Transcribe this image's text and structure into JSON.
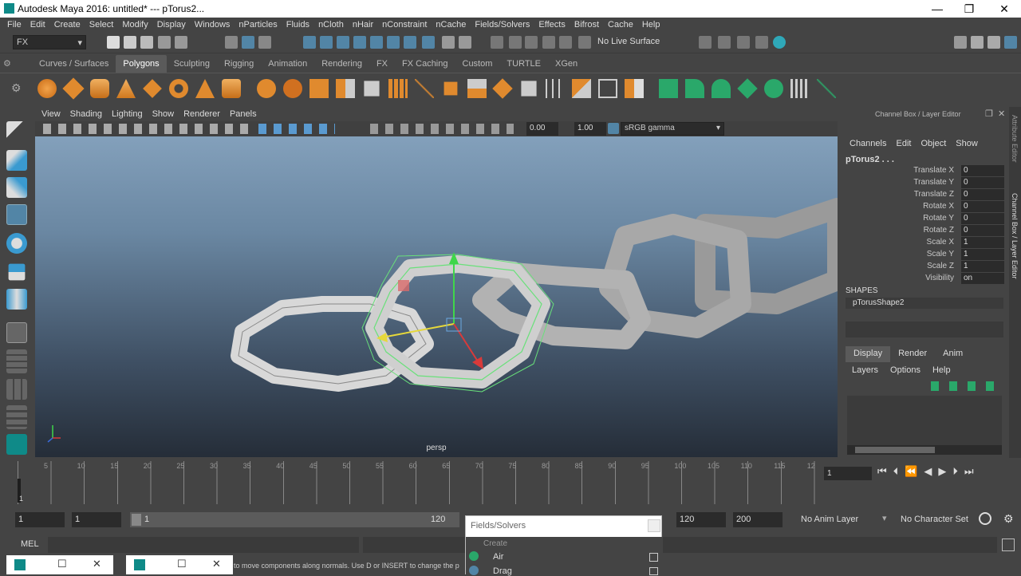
{
  "window": {
    "title": "Autodesk Maya 2016: untitled*   ---   pTorus2...",
    "minimize": "—",
    "restore": "❐",
    "close": "✕"
  },
  "menus": [
    "File",
    "Edit",
    "Create",
    "Select",
    "Modify",
    "Display",
    "Windows",
    "nParticles",
    "Fluids",
    "nCloth",
    "nHair",
    "nConstraint",
    "nCache",
    "Fields/Solvers",
    "Effects",
    "Bifrost",
    "Cache",
    "Help"
  ],
  "status": {
    "menuset": "FX",
    "live_surface": "No Live Surface"
  },
  "shelf_tabs": [
    "Curves / Surfaces",
    "Polygons",
    "Sculpting",
    "Rigging",
    "Animation",
    "Rendering",
    "FX",
    "FX Caching",
    "Custom",
    "TURTLE",
    "XGen"
  ],
  "active_shelf": "Polygons",
  "viewport": {
    "menus": [
      "View",
      "Shading",
      "Lighting",
      "Show",
      "Renderer",
      "Panels"
    ],
    "exposure": "0.00",
    "gamma": "1.00",
    "colorspace": "sRGB gamma",
    "camera": "persp"
  },
  "channel_box": {
    "title": "Channel Box / Layer Editor",
    "menus": [
      "Channels",
      "Edit",
      "Object",
      "Show"
    ],
    "object": "pTorus2 . . .",
    "attrs": [
      {
        "name": "Translate X",
        "value": "0"
      },
      {
        "name": "Translate Y",
        "value": "0"
      },
      {
        "name": "Translate Z",
        "value": "0"
      },
      {
        "name": "Rotate X",
        "value": "0"
      },
      {
        "name": "Rotate Y",
        "value": "0"
      },
      {
        "name": "Rotate Z",
        "value": "0"
      },
      {
        "name": "Scale X",
        "value": "1"
      },
      {
        "name": "Scale Y",
        "value": "1"
      },
      {
        "name": "Scale Z",
        "value": "1"
      },
      {
        "name": "Visibility",
        "value": "on"
      }
    ],
    "shapes_label": "SHAPES",
    "shape": "pTorusShape2",
    "layer_tabs": [
      "Display",
      "Render",
      "Anim"
    ],
    "layer_menus": [
      "Layers",
      "Options",
      "Help"
    ],
    "side_tabs": [
      "Attribute Editor",
      "Channel Box / Layer Editor"
    ]
  },
  "time": {
    "ticks": [
      "5",
      "10",
      "15",
      "20",
      "25",
      "30",
      "35",
      "40",
      "45",
      "50",
      "55",
      "60",
      "65",
      "70",
      "75",
      "80",
      "85",
      "90",
      "95",
      "100",
      "105",
      "110",
      "115",
      "12"
    ],
    "current": "1",
    "first_tick": "1"
  },
  "range": {
    "start": "1",
    "playback_start": "1",
    "slider_start": "1",
    "slider_end": "120",
    "playback_end": "120",
    "end": "200",
    "anim_layer": "No Anim Layer",
    "char_set": "No Character Set"
  },
  "command": {
    "label": "MEL"
  },
  "help": {
    "text": "to move components along normals. Use D or INSERT to change the p"
  },
  "popup": {
    "title": "Fields/Solvers",
    "section": "Create",
    "items": [
      "Air",
      "Drag"
    ]
  },
  "colors": {
    "accent": "#5285a6",
    "selection": "#69e07a",
    "active_tab": "#5a5a5a"
  }
}
